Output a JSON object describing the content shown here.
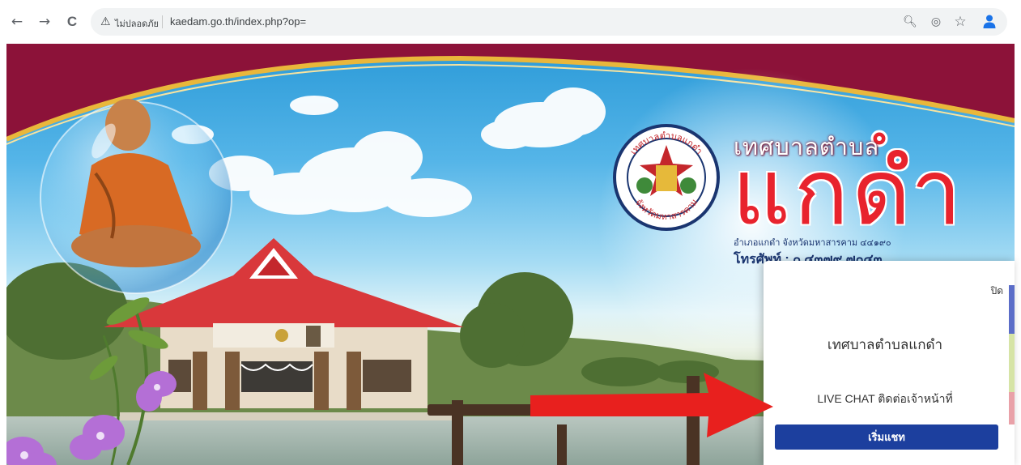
{
  "browser": {
    "back_icon": "back-arrow-icon",
    "back_glyph": "←",
    "forward_icon": "forward-arrow-icon",
    "forward_glyph": "→",
    "reload_icon": "reload-icon",
    "reload_glyph": "C",
    "security_icon": "warning-triangle-icon",
    "security_glyph": "⚠",
    "security_label": "ไม่ปลอดภัย",
    "url": "kaedam.go.th/index.php?op=",
    "zoom_glyph": "🔍︎",
    "eye_glyph": "◎",
    "star_glyph": "☆"
  },
  "banner": {
    "title_small": "เทศบาลตำบล",
    "title_big": "แกดำ",
    "seal_top_text": "เทศบาลตำบลแกดำ",
    "seal_bottom_text": "จังหวัดมหาสารคาม",
    "address": "อำเภอแกดำ จังหวัดมหาสารคาม ๔๔๑๙๐",
    "telephone": "โทรศัพท์ : ๐ ๔๓๗๙ ๗๐๔๓",
    "colors": {
      "maroon": "#8c1239",
      "gold": "#e9b73b",
      "title_red": "#e8232d",
      "navy": "#1a3570"
    }
  },
  "chat": {
    "close_label": "ปิด",
    "org_name": "เทศบาลตำบลแกดำ",
    "subtitle": "LIVE CHAT ติดต่อเจ้าหน้าที่",
    "start_button": "เริ่มแชท",
    "button_color": "#1c3f9e"
  },
  "annotation": {
    "arrow_color": "#e8201e",
    "icon": "red-arrow-icon"
  }
}
